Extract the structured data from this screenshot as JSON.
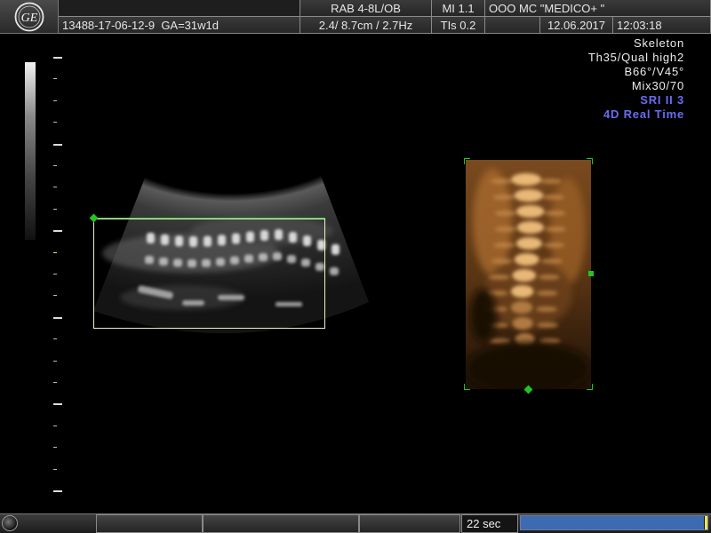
{
  "header": {
    "probe": "RAB 4-8L/OB",
    "mi": "MI  1.1",
    "tis": "TIs  0.2",
    "clinic": "OOO  MC \"MEDICO+ \"",
    "patient_id": "13488-17-06-12-9",
    "gestational_age": "GA=31w1d",
    "params": "2.4/ 8.7cm / 2.7Hz",
    "date": "12.06.2017",
    "time": "12:03:18",
    "logo": "GE"
  },
  "info": {
    "lines": [
      {
        "text": "Skeleton",
        "color": "#ececec"
      },
      {
        "text": "Th35/Qual high2",
        "color": "#ececec"
      },
      {
        "text": "B66°/V45°",
        "color": "#ececec"
      },
      {
        "text": "Mix30/70",
        "color": "#ececec"
      },
      {
        "text": "SRI II 3",
        "color": "#6a6cf2"
      },
      {
        "text": "4D Real Time",
        "color": "#6a6cf2"
      }
    ]
  },
  "footer": {
    "timer": "22 sec",
    "progress_fraction": 0.98,
    "progress_color": "#3d6ab0",
    "progress_end_color": "#f1e44a"
  },
  "colors": {
    "roi_green": "#22c322",
    "roi_box": "#f0f0c8",
    "render_amber": "#c07a35"
  },
  "icons": {
    "logo": "ge-logo-icon",
    "knob": "trackball-icon"
  }
}
